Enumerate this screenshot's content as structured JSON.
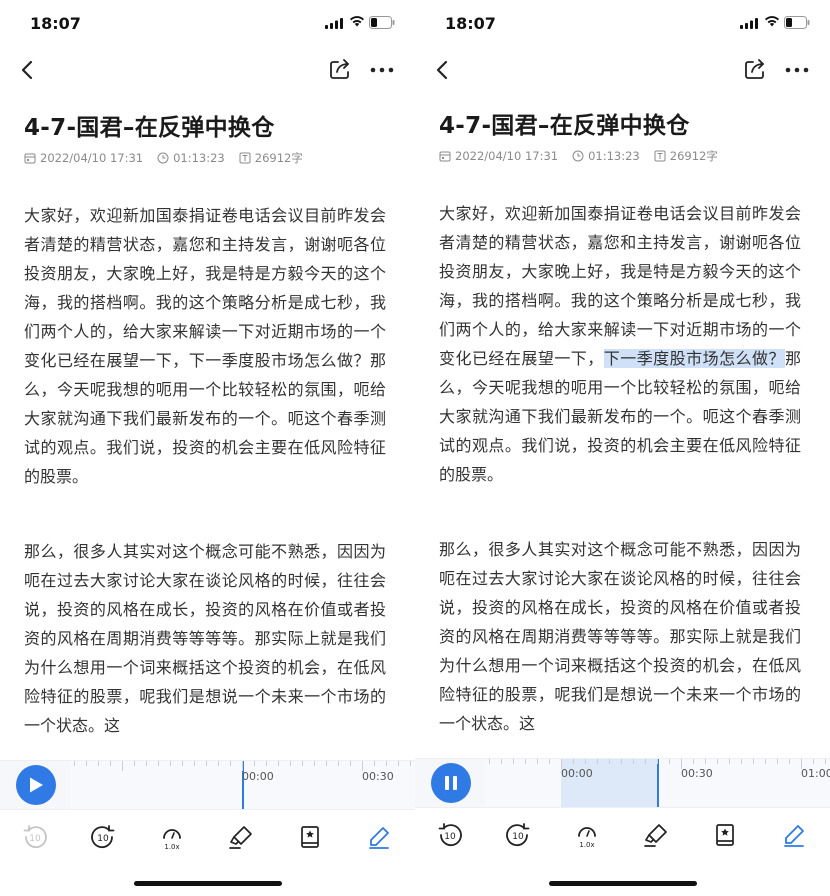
{
  "status": {
    "time": "18:07"
  },
  "article": {
    "title": "4-7-国君–在反弹中换仓",
    "date": "2022/04/10 17:31",
    "duration": "01:13:23",
    "word_count": "26912字",
    "p1_a": "大家好，欢迎新加国泰捐证卷电话会议目前昨发会者清楚的精营状态，嘉您和主持发言，谢谢呃各位投资朋友，大家晚上好，我是特是方毅今天的这个海，我的搭档啊。我的这个策略分析是成七秒，我们两个人的，给大家来解读一下对近期市场的一个变化已经在展望一下，",
    "p1_hl": "下一季度股市场怎么做？",
    "p1_b": "那么，今天呢我想的呃用一个比较轻松的氛围，呃给大家就沟通下我们最新发布的一个。呃这个春季测试的观点。我们说，投资的机会主要在低风险特征的股票。",
    "p2": "那么，很多人其实对这个概念可能不熟悉，因因为呃在过去大家讨论大家在谈论风格的时候，往往会说，投资的风格在成长，投资的风格在价值或者投资的风格在周期消费等等等等。那实际上就是我们为什么想用一个词来概括这个投资的机会，在低风险特征的股票，呢我们是想说一个未来一个市场的一个状态。这"
  },
  "left_player": {
    "state": "paused",
    "labels": [
      "00:00",
      "00:30"
    ]
  },
  "right_player": {
    "state": "playing",
    "labels": [
      "00:00",
      "00:30",
      "01:00"
    ]
  },
  "toolbar": {
    "items": [
      "rewind-10-icon",
      "forward-10-icon",
      "speed-icon",
      "highlighter-icon",
      "bookmark-icon",
      "edit-icon"
    ],
    "speed_label": "1.0x",
    "rewind_label": "10",
    "forward_label": "10"
  },
  "colors": {
    "accent": "#2f7ae5",
    "highlight": "#cfe0f7"
  }
}
